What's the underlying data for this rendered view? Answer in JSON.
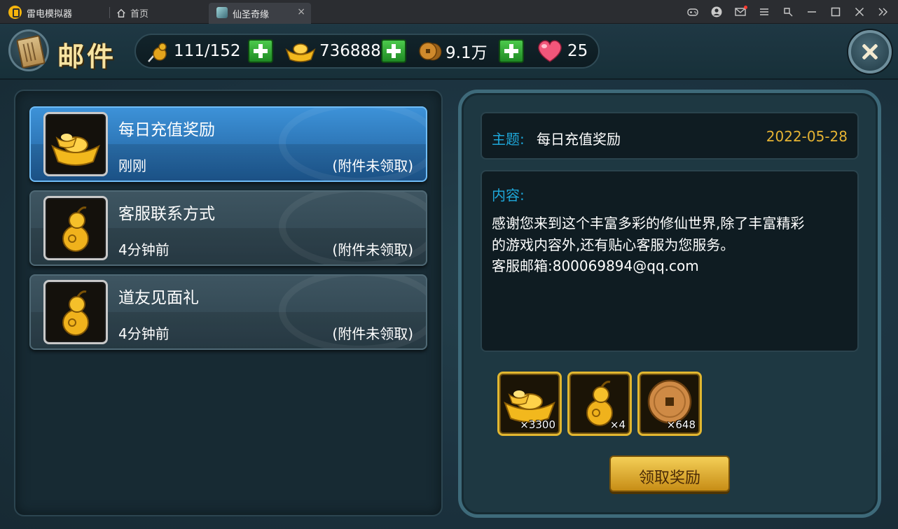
{
  "emulator": {
    "app_name": "雷电模拟器",
    "home_tab": "首页",
    "game_tab": "仙圣奇缘",
    "tab_close": "×"
  },
  "header": {
    "title": "邮件",
    "resources": [
      {
        "icon": "gourd-stamina-icon",
        "value": "111/152"
      },
      {
        "icon": "gold-ingot-icon",
        "value": "736888"
      },
      {
        "icon": "copper-coin-icon",
        "value": "9.1万"
      },
      {
        "icon": "heart-icon",
        "value": "25"
      }
    ]
  },
  "mail_list": [
    {
      "title": "每日充值奖励",
      "time": "刚刚",
      "status": "(附件未领取)",
      "icon": "gold-ingot-icon",
      "selected": true
    },
    {
      "title": "客服联系方式",
      "time": "4分钟前",
      "status": "(附件未领取)",
      "icon": "golden-gourd-icon",
      "selected": false
    },
    {
      "title": "道友见面礼",
      "time": "4分钟前",
      "status": "(附件未领取)",
      "icon": "golden-gourd-icon",
      "selected": false
    }
  ],
  "detail": {
    "subject_label": "主题:",
    "subject": "每日充值奖励",
    "date": "2022-05-28",
    "content_label": "内容:",
    "content_lines": [
      "感谢您来到这个丰富多彩的修仙世界,除了丰富精彩",
      "的游戏内容外,还有贴心客服为您服务。",
      "客服邮箱:800069894@qq.com"
    ],
    "rewards": [
      {
        "icon": "gold-ingot-icon",
        "count": "×3300"
      },
      {
        "icon": "golden-gourd-icon",
        "count": "×4"
      },
      {
        "icon": "copper-coin-icon",
        "count": "×648"
      }
    ],
    "claim_button": "领取奖励"
  },
  "colors": {
    "selected_item": "#2f7fc4",
    "label_blue": "#1ea6d8",
    "date_gold": "#e5b333",
    "button_gold": "#e0ae2e"
  }
}
